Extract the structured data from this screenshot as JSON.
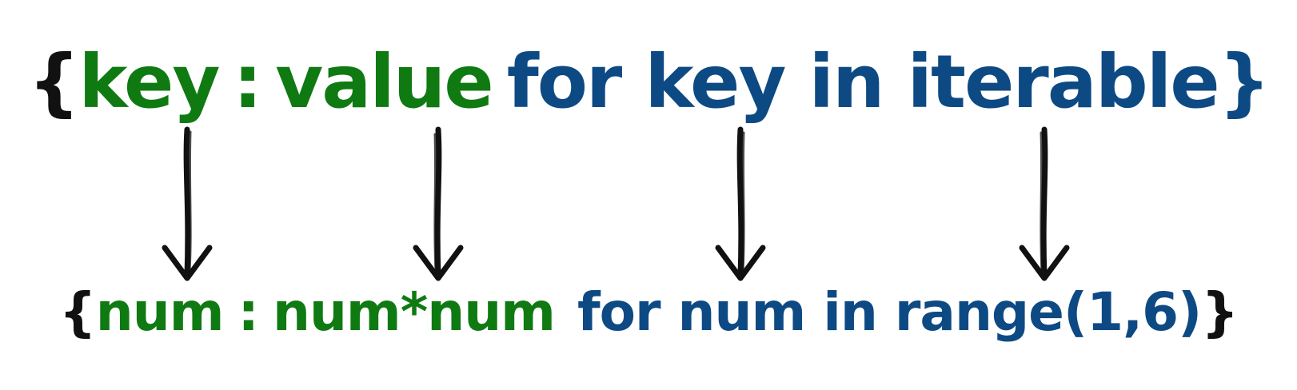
{
  "colors": {
    "brace": "#111111",
    "green": "#0f7a12",
    "blue": "#0d4a84"
  },
  "syntax": {
    "open_brace": "{",
    "key": "key",
    "colon": ":",
    "value": "value",
    "for_clause": "for key in iterable",
    "close_brace": "}"
  },
  "example": {
    "open_brace": "{",
    "key": "num",
    "colon": ":",
    "value": "num*num",
    "for_clause": "for num in range(1,6)",
    "close_brace": "}"
  },
  "arrows": [
    {
      "maps": "key → num"
    },
    {
      "maps": "value → num*num"
    },
    {
      "maps": "key → num"
    },
    {
      "maps": "iterable → range(1,6)"
    }
  ]
}
